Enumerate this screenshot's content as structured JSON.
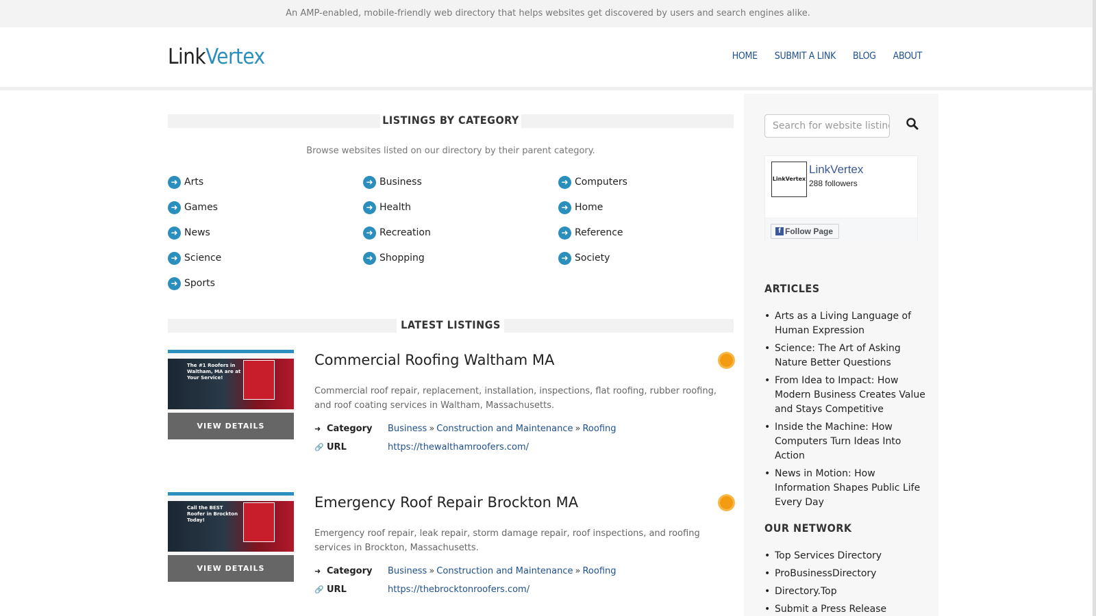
{
  "topbar": {
    "text": "An AMP-enabled, mobile-friendly web directory that helps websites get discovered by users and search engines alike."
  },
  "logo": {
    "part1": "Link",
    "part2": "Vertex"
  },
  "nav": [
    {
      "label": "Home"
    },
    {
      "label": "Submit a Link"
    },
    {
      "label": "Blog"
    },
    {
      "label": "About"
    }
  ],
  "categories_section": {
    "title": "LISTINGS BY CATEGORY",
    "subtitle": "Browse websites listed on our directory by their parent category.",
    "items": [
      "Arts",
      "Business",
      "Computers",
      "Games",
      "Health",
      "Home",
      "News",
      "Recreation",
      "Reference",
      "Science",
      "Shopping",
      "Society",
      "Sports"
    ]
  },
  "latest_section": {
    "title": "LATEST LISTINGS"
  },
  "listings": [
    {
      "title": "Commercial Roofing Waltham MA",
      "description": "Commercial roof repair, replacement, installation, inspections, flat roofing, rubber roofing, and roof coating services in Waltham, Massachusetts.",
      "category_label": "Category",
      "categories": [
        "Business",
        "Construction and Maintenance",
        "Roofing"
      ],
      "url_label": "URL",
      "url": "https://thewalthamroofers.com/",
      "view_label": "VIEW DETAILS",
      "thumb_headline": "The #1 Roofers in Waltham, MA are at Your Service!"
    },
    {
      "title": "Emergency Roof Repair Brockton MA",
      "description": "Emergency roof repair, leak repair, storm damage repair, roof inspections, and roofing services in Brockton, Massachusetts.",
      "category_label": "Category",
      "categories": [
        "Business",
        "Construction and Maintenance",
        "Roofing"
      ],
      "url_label": "URL",
      "url": "https://thebrocktonroofers.com/",
      "view_label": "VIEW DETAILS",
      "thumb_headline": "Call the BEST Roofer in Brockton Today!"
    }
  ],
  "sidebar": {
    "search_placeholder": "Search for website listings",
    "facebook": {
      "page_name": "LinkVertex",
      "followers": "288 followers",
      "follow_label": "Follow Page",
      "pic_text": "LinkVertex"
    },
    "articles_title": "ARTICLES",
    "articles": [
      "Arts as a Living Language of Human Expression",
      "Science: The Art of Asking Nature Better Questions",
      "From Idea to Impact: How Modern Business Creates Value and Stays Competitive",
      "Inside the Machine: How Computers Turn Ideas Into Action",
      "News in Motion: How Information Shapes Public Life Every Day"
    ],
    "network_title": "OUR NETWORK",
    "network": [
      "Top Services Directory",
      "ProBusinessDirectory",
      "Directory.Top",
      "Submit a Press Release"
    ]
  },
  "colors": {
    "accent": "#2a8fbd",
    "link": "#1f4f8f",
    "badge": "#f39c12"
  }
}
